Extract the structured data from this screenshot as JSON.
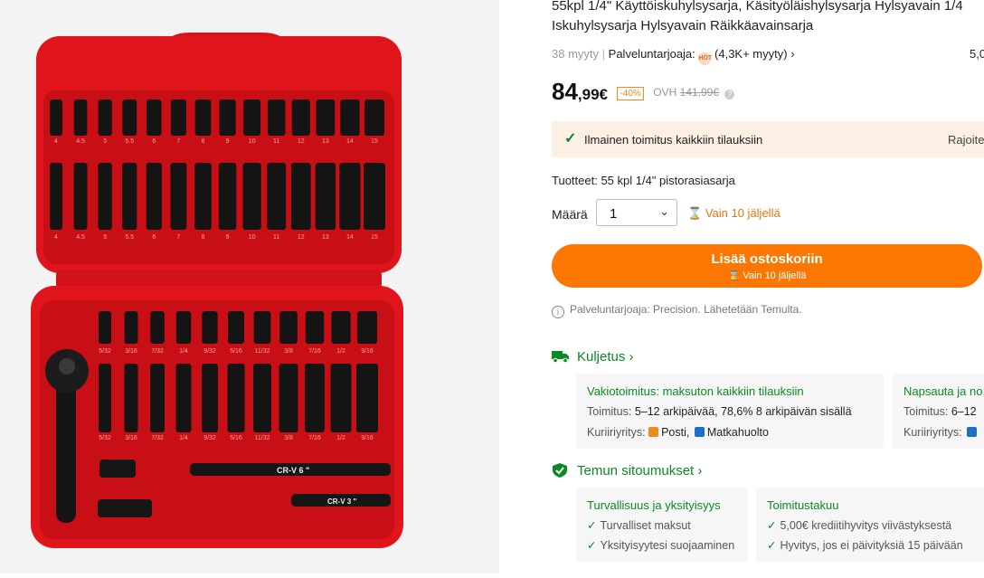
{
  "product": {
    "title_line1": "55kpl 1/4\" Käyttöiskuhylsysarja, Käsityöläishylsysarja Hylsyavain 1/4",
    "title_line2": "Iskuhylsysarja Hylsyavain Räikkäavainsarja",
    "sold": "38 myyty",
    "sep": "|",
    "seller_label": "Palveluntarjoaja:",
    "seller_badge": "HOT",
    "seller_stats": "(4,3K+ myyty)",
    "right_num": "5,0"
  },
  "price": {
    "main": "84",
    "cents": ",99€",
    "discount": "-40%",
    "orig_label": "OVH",
    "orig_price": "141,99€"
  },
  "shipping_banner": {
    "text": "Ilmainen toimitus kaikkiin tilauksiin",
    "right": "Rajoite"
  },
  "variant": "Tuotteet: 55 kpl 1/4\" pistorasiasarja",
  "quantity": {
    "label": "Määrä",
    "value": "1",
    "stock": "Vain 10 jäljellä"
  },
  "cart": {
    "label": "Lisää ostoskoriin",
    "sub": "Vain 10 jäljellä"
  },
  "seller_note": "Palveluntarjoaja: Precision. Lähetetään Temulta.",
  "delivery": {
    "heading": "Kuljetus",
    "card1": {
      "title": "Vakiotoimitus: maksuton kaikkiin tilauksiin",
      "line1_label": "Toimitus:",
      "line1_value": "5–12 arkipäivää, 78,6% 8 arkipäivän sisällä",
      "line2_label": "Kuriiriyritys:",
      "courier1": "Posti,",
      "courier2": "Matkahuolto"
    },
    "card2": {
      "title": "Napsauta ja no",
      "line1_label": "Toimitus:",
      "line1_value": "6–12",
      "line2_label": "Kuriiriyritys:"
    }
  },
  "commitments": {
    "heading": "Temun sitoumukset",
    "card1": {
      "title": "Turvallisuus ja yksityisyys",
      "items": [
        "Turvalliset maksut",
        "Yksityisyytesi suojaaminen"
      ]
    },
    "card2": {
      "title": "Toimitustakuu",
      "items": [
        "5,00€ krediitihyvitys viivästyksestä",
        "Hyvitys, jos ei päivityksiä 15 päivään"
      ]
    }
  },
  "image": {
    "top_sizes": [
      "4",
      "4.5",
      "5",
      "5.5",
      "6",
      "7",
      "8",
      "9",
      "10",
      "11",
      "12",
      "13",
      "14",
      "15"
    ],
    "bottom_sizes": [
      "5/32",
      "3/16",
      "7/32",
      "1/4",
      "9/32",
      "5/16",
      "11/32",
      "3/8",
      "7/16",
      "1/2",
      "9/16"
    ],
    "ext6": "CR-V  6 \"",
    "ext3": "CR-V  3 \""
  },
  "colors": {
    "accent": "#fb7701",
    "green": "#0a8a24",
    "case_red": "#e0141b"
  }
}
